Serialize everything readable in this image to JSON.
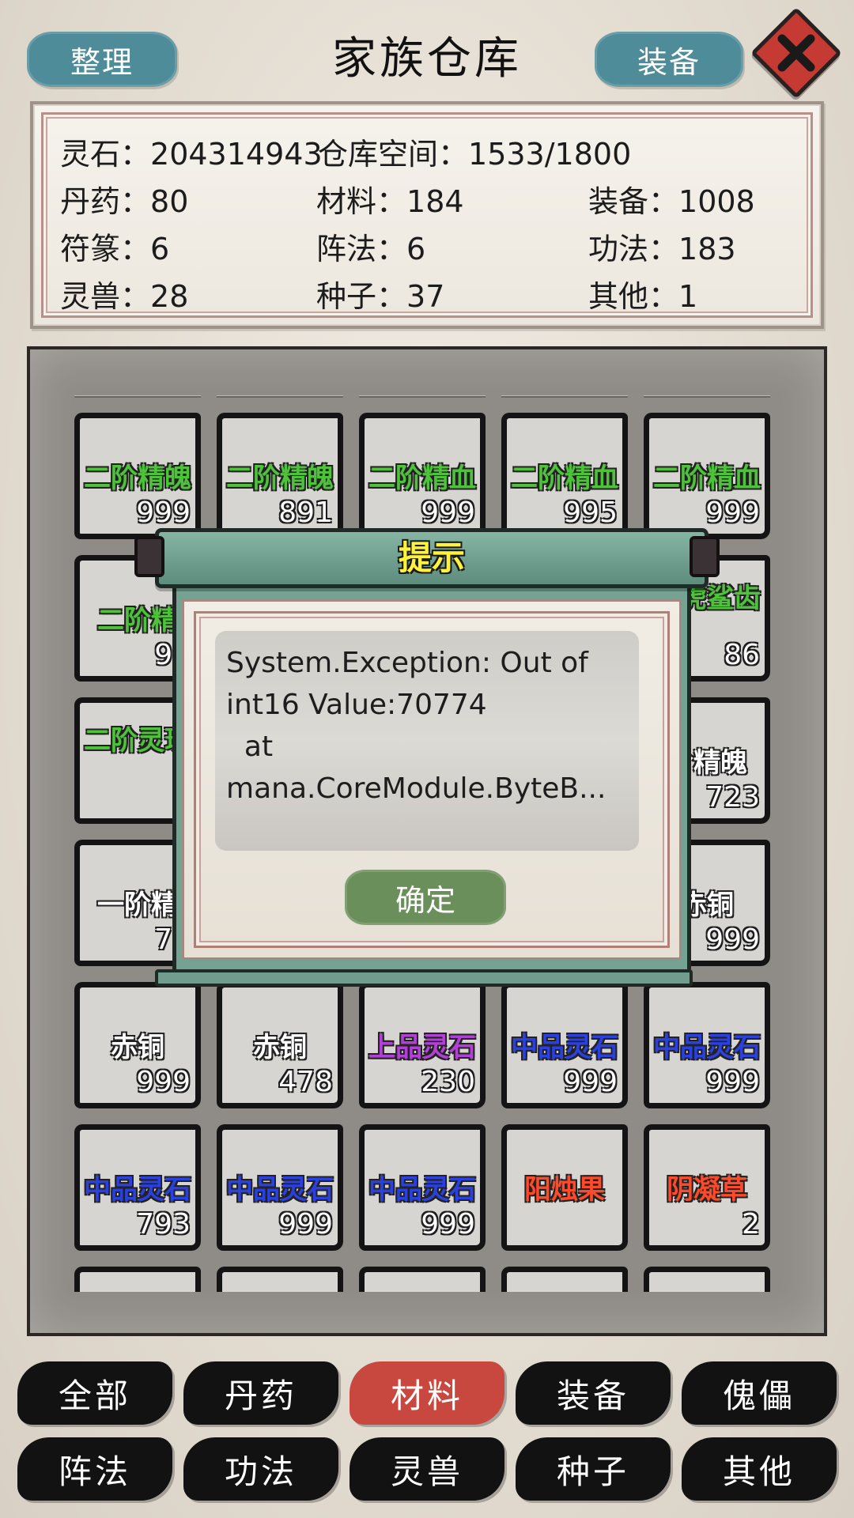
{
  "header": {
    "sort_label": "整理",
    "title": "家族仓库",
    "equip_label": "装备"
  },
  "stats": {
    "spirit_stone": {
      "label": "灵石",
      "value": "204314943"
    },
    "storage": {
      "label": "仓库空间",
      "value": "1533/1800"
    },
    "row2": [
      {
        "label": "丹药",
        "value": "80"
      },
      {
        "label": "材料",
        "value": "184"
      },
      {
        "label": "装备",
        "value": "1008"
      }
    ],
    "row3": [
      {
        "label": "符篆",
        "value": "6"
      },
      {
        "label": "阵法",
        "value": "6"
      },
      {
        "label": "功法",
        "value": "183"
      }
    ],
    "row4": [
      {
        "label": "灵兽",
        "value": "28"
      },
      {
        "label": "种子",
        "value": "37"
      },
      {
        "label": "其他",
        "value": "1"
      }
    ]
  },
  "colors": {
    "green": "#4fc23c",
    "white": "#ffffff",
    "purple": "#b340d6",
    "blue": "#2a40e0",
    "red": "#ff4a2a",
    "active_tab": "#c84840"
  },
  "items": [
    {
      "name": "二阶精魄",
      "count": "999",
      "color": "green"
    },
    {
      "name": "二阶精魄",
      "count": "891",
      "color": "green"
    },
    {
      "name": "二阶精血",
      "count": "999",
      "color": "green"
    },
    {
      "name": "二阶精血",
      "count": "995",
      "color": "green"
    },
    {
      "name": "二阶精血",
      "count": "999",
      "color": "green"
    },
    {
      "name": "二阶精",
      "count": "99",
      "color": "green"
    },
    {
      "name": "",
      "count": "",
      "color": "green"
    },
    {
      "name": "",
      "count": "",
      "color": "green"
    },
    {
      "name": "",
      "count": "",
      "color": "green"
    },
    {
      "name": "阶虎鲨齿",
      "count": "86",
      "color": "green",
      "wrap": true
    },
    {
      "name": "二阶灵珠",
      "count": "9",
      "color": "green",
      "wrap": true
    },
    {
      "name": "",
      "count": "",
      "color": "green"
    },
    {
      "name": "",
      "count": "",
      "color": "green"
    },
    {
      "name": "",
      "count": "",
      "color": "green"
    },
    {
      "name": "阶精魄",
      "count": "723",
      "color": "white"
    },
    {
      "name": "一阶精",
      "count": "76",
      "color": "white"
    },
    {
      "name": "",
      "count": "",
      "color": "white"
    },
    {
      "name": "",
      "count": "",
      "color": "white"
    },
    {
      "name": "",
      "count": "",
      "color": "white"
    },
    {
      "name": "赤铜",
      "count": "999",
      "color": "white"
    },
    {
      "name": "赤铜",
      "count": "999",
      "color": "white"
    },
    {
      "name": "赤铜",
      "count": "478",
      "color": "white"
    },
    {
      "name": "上品灵石",
      "count": "230",
      "color": "purple"
    },
    {
      "name": "中品灵石",
      "count": "999",
      "color": "blue"
    },
    {
      "name": "中品灵石",
      "count": "999",
      "color": "blue"
    },
    {
      "name": "中品灵石",
      "count": "793",
      "color": "blue"
    },
    {
      "name": "中品灵石",
      "count": "999",
      "color": "blue"
    },
    {
      "name": "中品灵石",
      "count": "999",
      "color": "blue"
    },
    {
      "name": "阳烛果",
      "count": "",
      "color": "red"
    },
    {
      "name": "阴凝草",
      "count": "2",
      "color": "red"
    },
    {
      "name": "",
      "count": "",
      "color": "white"
    },
    {
      "name": "",
      "count": "",
      "color": "white"
    },
    {
      "name": "",
      "count": "",
      "color": "white"
    },
    {
      "name": "",
      "count": "",
      "color": "white"
    },
    {
      "name": "",
      "count": "",
      "color": "white"
    }
  ],
  "modal": {
    "title": "提示",
    "message": "System.Exception: Out of int16 Value:70774\n  at\nmana.CoreModule.ByteB...",
    "confirm_label": "确定"
  },
  "tabs": [
    {
      "label": "全部",
      "active": false
    },
    {
      "label": "丹药",
      "active": false
    },
    {
      "label": "材料",
      "active": true
    },
    {
      "label": "装备",
      "active": false
    },
    {
      "label": "傀儡",
      "active": false
    },
    {
      "label": "阵法",
      "active": false
    },
    {
      "label": "功法",
      "active": false
    },
    {
      "label": "灵兽",
      "active": false
    },
    {
      "label": "种子",
      "active": false
    },
    {
      "label": "其他",
      "active": false
    }
  ]
}
